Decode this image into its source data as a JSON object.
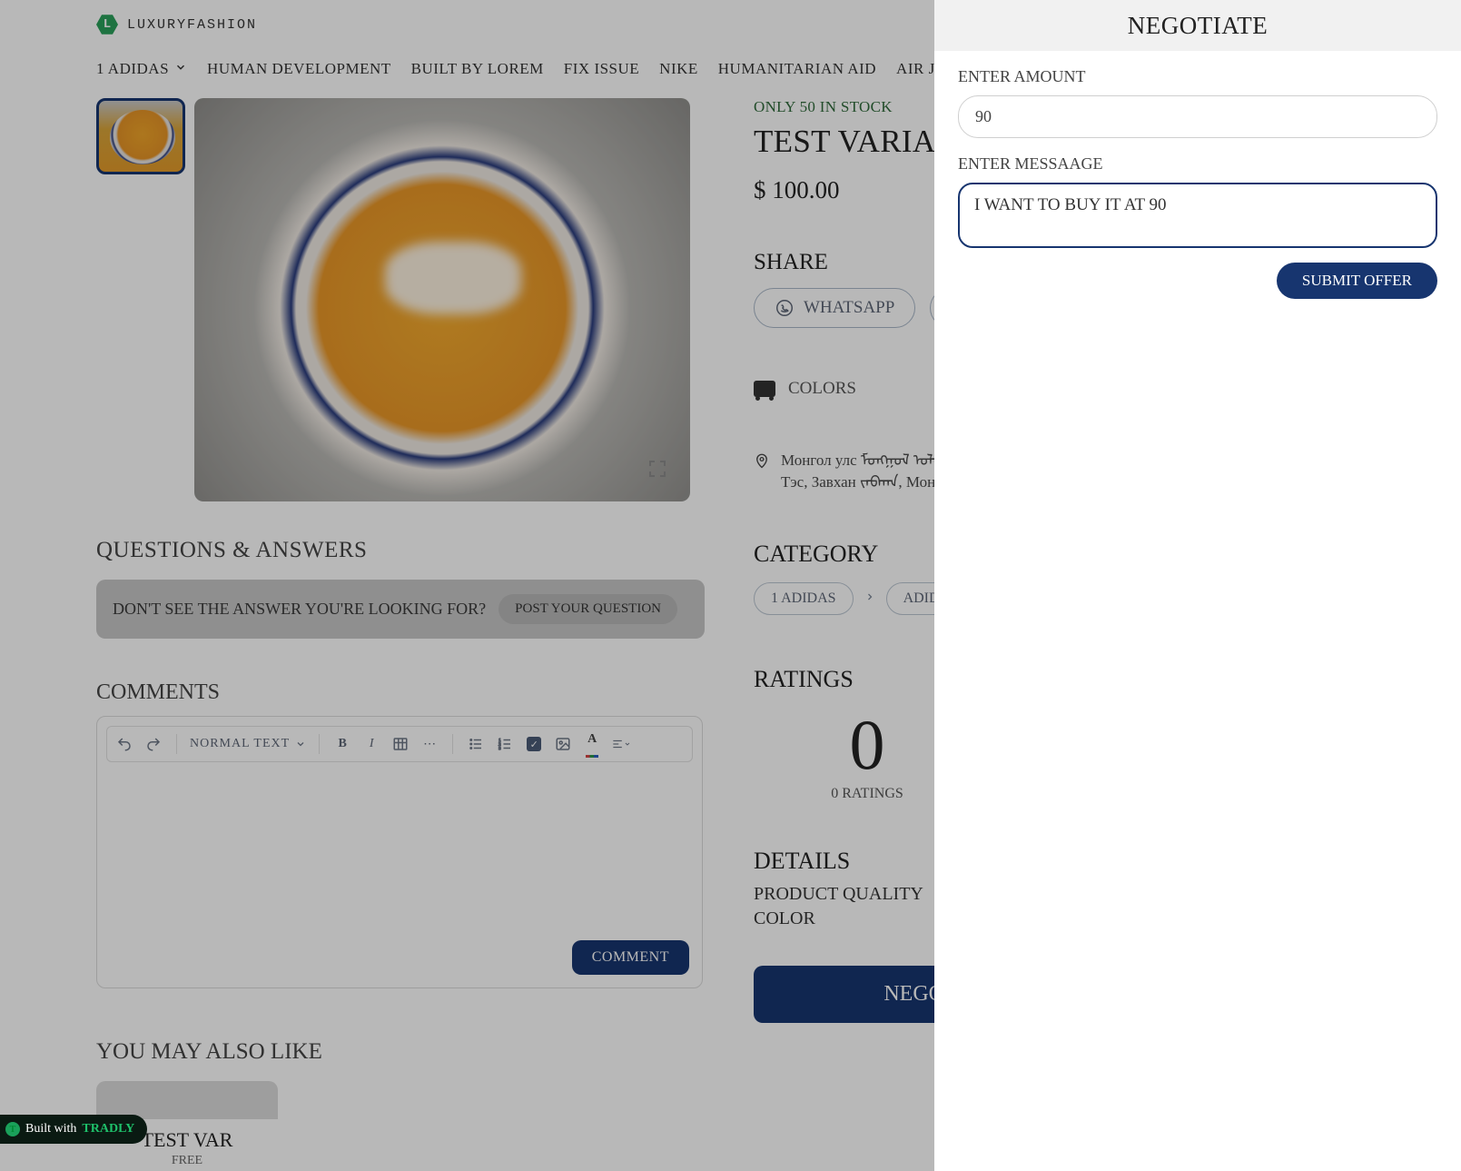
{
  "brand": {
    "name": "LUXURYFASHION",
    "logo_letter": "L"
  },
  "nav": {
    "items": [
      {
        "label": "1 ADIDAS",
        "has_dropdown": true
      },
      {
        "label": "HUMAN DEVELOPMENT"
      },
      {
        "label": "BUILT BY LOREM"
      },
      {
        "label": "FIX ISSUE"
      },
      {
        "label": "NIKE"
      },
      {
        "label": "HUMANITARIAN AID"
      },
      {
        "label": "AIR JORDAN"
      }
    ]
  },
  "product": {
    "stock_text": "ONLY 50 IN STOCK",
    "title": "TEST VARIANT",
    "price": "$ 100.00",
    "share_title": "SHARE",
    "share_whatsapp": "WHATSAPP",
    "colors_label": "COLORS",
    "location_line1": "Монгол улс ᠮᠣᠩᠭᠣᠯ ᠤᠯᠤᠰ",
    "location_line2": "Тэс, Завхан ᠵᠠᠪᠬᠠᠨ, Монгол",
    "category_title": "CATEGORY",
    "breadcrumbs": [
      "1 ADIDAS",
      "ADIDAS CH"
    ],
    "ratings_title": "RATINGS",
    "rating_value": "0",
    "rating_sub": "0 RATINGS",
    "details_title": "DETAILS",
    "details": [
      "PRODUCT QUALITY",
      "COLOR"
    ],
    "negotiate_button": "NEGOTIATE"
  },
  "qa": {
    "title": "QUESTIONS & ANSWERS",
    "prompt": "DON'T SEE THE ANSWER YOU'RE LOOKING FOR?",
    "button": "POST YOUR QUESTION"
  },
  "comments": {
    "title": "COMMENTS",
    "toolbar_text_style": "NORMAL TEXT",
    "submit": "COMMENT"
  },
  "ymal": {
    "title": "YOU MAY ALSO LIKE",
    "card_title": "TEST VAR",
    "card_price": "FREE"
  },
  "builtwith": {
    "prefix": "Built with ",
    "brand": "TRADLY"
  },
  "panel": {
    "title": "NEGOTIATE",
    "amount_label": "ENTER AMOUNT",
    "amount_value": "90",
    "message_label": "ENTER MESSAAGE",
    "message_value": "I WANT TO BUY IT AT 90",
    "submit": "SUBMIT OFFER"
  }
}
